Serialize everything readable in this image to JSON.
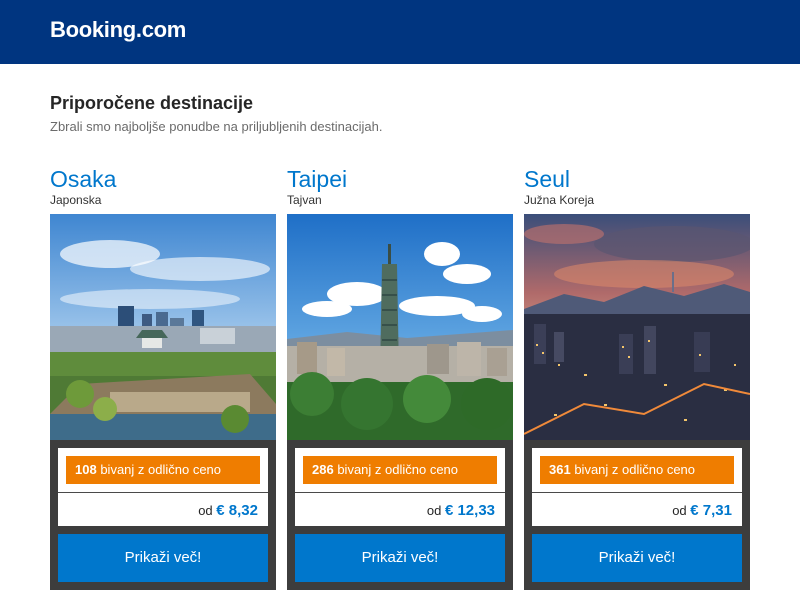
{
  "header": {
    "logo": "Booking.com",
    "bg_color": "#003580"
  },
  "section": {
    "title": "Priporočene destinacije",
    "subtitle": "Zbrali smo najboljše ponudbe na priljubljenih destinacijah."
  },
  "destinations": [
    {
      "city": "Osaka",
      "country": "Japonska",
      "deal_count": "108",
      "deal_text": "bivanj z odlično ceno",
      "price_prefix": "od",
      "price": "€ 8,32",
      "button": "Prikaži več!",
      "image_icon": "osaka-castle-skyline-photo"
    },
    {
      "city": "Taipei",
      "country": "Tajvan",
      "deal_count": "286",
      "deal_text": "bivanj z odlično ceno",
      "price_prefix": "od",
      "price": "€ 12,33",
      "button": "Prikaži več!",
      "image_icon": "taipei-101-skyline-photo"
    },
    {
      "city": "Seul",
      "country": "Južna Koreja",
      "deal_count": "361",
      "deal_text": "bivanj z odlično ceno",
      "price_prefix": "od",
      "price": "€ 7,31",
      "button": "Prikaži več!",
      "image_icon": "seoul-dusk-cityscape-photo"
    }
  ],
  "colors": {
    "accent_blue": "#0077cc",
    "badge_orange": "#ef7d00",
    "panel_dark": "#3d3d3d"
  }
}
